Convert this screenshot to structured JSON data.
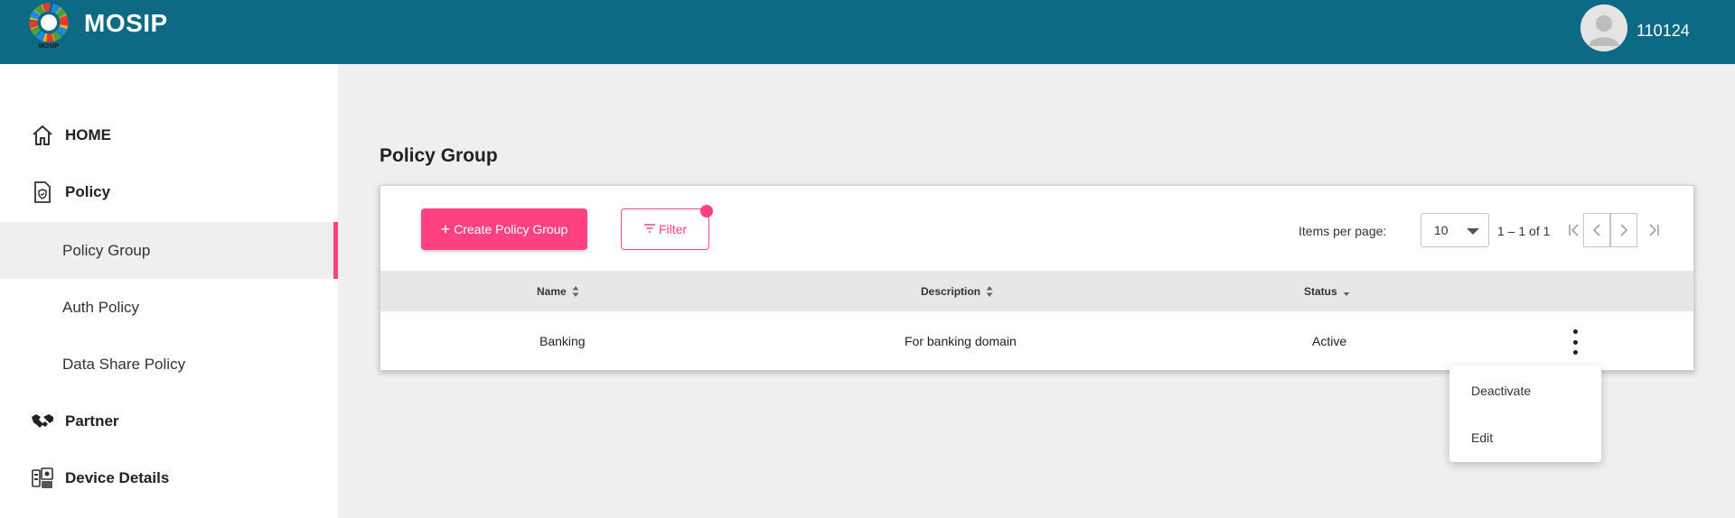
{
  "header": {
    "brand": "MOSIP",
    "logo_text": "MOSIP",
    "user_id": "110124",
    "color": "#0d6a84"
  },
  "sidebar": {
    "items": [
      {
        "label": "HOME",
        "icon": "home-icon"
      },
      {
        "label": "Policy",
        "icon": "policy-document-icon"
      },
      {
        "label": "Policy Group",
        "sub": true,
        "active": true
      },
      {
        "label": "Auth Policy",
        "sub": true
      },
      {
        "label": "Data Share Policy",
        "sub": true
      },
      {
        "label": "Partner",
        "icon": "handshake-icon"
      },
      {
        "label": "Device Details",
        "icon": "device-icon"
      }
    ],
    "accent_color": "#ff4081"
  },
  "main": {
    "title": "Policy Group",
    "create_button": "Create Policy Group",
    "filter_button": "Filter",
    "pagination": {
      "items_per_page_label": "Items per page:",
      "items_per_page_value": "10",
      "range_label": "1 – 1 of 1"
    },
    "table": {
      "columns": [
        "Name",
        "Description",
        "Status"
      ],
      "rows": [
        {
          "name": "Banking",
          "description": "For banking domain",
          "status": "Active"
        }
      ]
    }
  },
  "context_menu": {
    "items": [
      "Deactivate",
      "Edit"
    ]
  }
}
